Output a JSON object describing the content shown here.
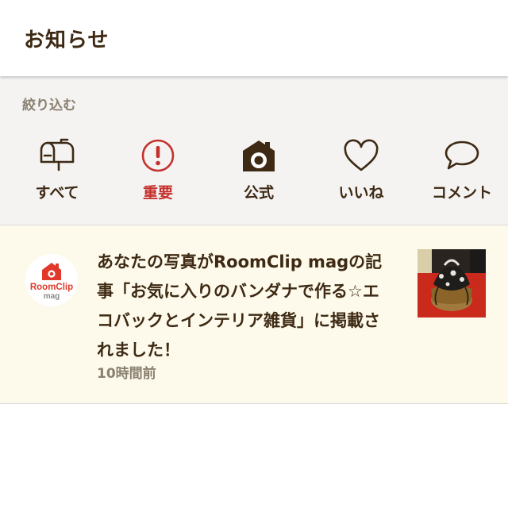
{
  "header": {
    "title": "お知らせ"
  },
  "filter": {
    "label": "絞り込む",
    "tabs": [
      {
        "label": "すべて",
        "icon": "mailbox-icon",
        "active": false
      },
      {
        "label": "重要",
        "icon": "exclamation-circle-icon",
        "active": true
      },
      {
        "label": "公式",
        "icon": "camera-house-icon",
        "active": false
      },
      {
        "label": "いいね",
        "icon": "heart-icon",
        "active": false
      },
      {
        "label": "コメント",
        "icon": "speech-bubble-icon",
        "active": false
      }
    ]
  },
  "notification": {
    "avatar_text_line1": "RoomClip",
    "avatar_text_line2": "mag",
    "message": "あなたの写真がRoomClip magの記事「お気に入りのバンダナで作る☆エコバックとインテリア雑貨」に掲載されました！",
    "time": "10時間前"
  },
  "colors": {
    "text_dark": "#3e2a14",
    "accent_red": "#c4312c",
    "filter_bg": "#f4f3f2",
    "notification_bg": "#fdfaeb",
    "muted": "#8a8070"
  }
}
